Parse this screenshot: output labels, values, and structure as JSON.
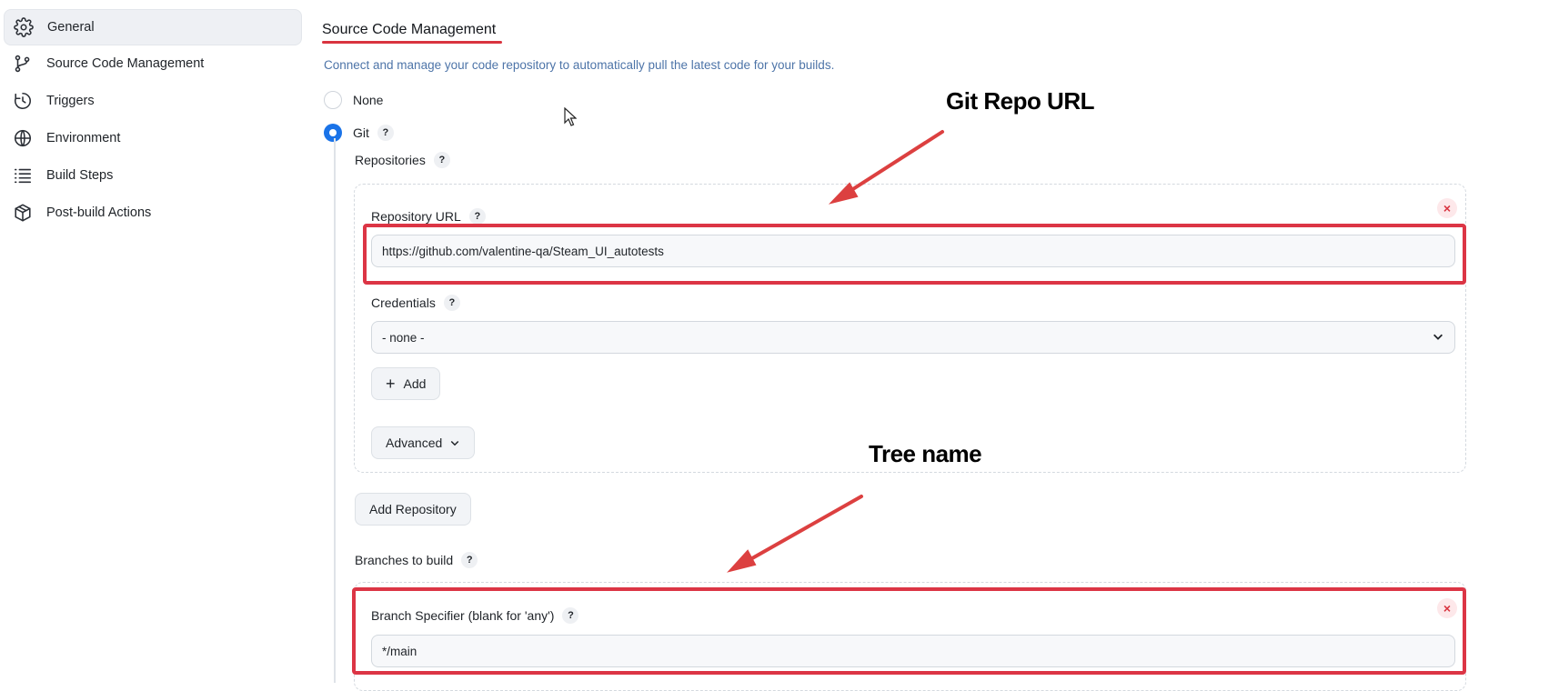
{
  "sidebar": {
    "items": [
      {
        "label": "General",
        "icon": "gear-icon"
      },
      {
        "label": "Source Code Management",
        "icon": "branch-icon"
      },
      {
        "label": "Triggers",
        "icon": "clock-icon"
      },
      {
        "label": "Environment",
        "icon": "globe-icon"
      },
      {
        "label": "Build Steps",
        "icon": "list-icon"
      },
      {
        "label": "Post-build Actions",
        "icon": "package-icon"
      }
    ]
  },
  "scm": {
    "title": "Source Code Management",
    "description": "Connect and manage your code repository to automatically pull the latest code for your builds.",
    "options": {
      "none": "None",
      "git": "Git"
    },
    "selected": "Git",
    "repositories_label": "Repositories",
    "repo": {
      "url_label": "Repository URL",
      "url_value": "https://github.com/valentine-qa/Steam_UI_autotests",
      "credentials_label": "Credentials",
      "credentials_value": "- none -",
      "add_label": "Add",
      "advanced_label": "Advanced"
    },
    "add_repository_label": "Add Repository",
    "branches_label": "Branches to build",
    "branch": {
      "specifier_label": "Branch Specifier (blank for 'any')",
      "specifier_value": "*/main"
    },
    "help_glyph": "?",
    "close_glyph": "×"
  },
  "annotations": {
    "repo_note": "Git Repo URL",
    "tree_note": "Tree name",
    "highlight_color": "#dc3545"
  },
  "colors": {
    "accent": "#1a73e8",
    "danger": "#d9333f",
    "description": "#4d74a8"
  }
}
